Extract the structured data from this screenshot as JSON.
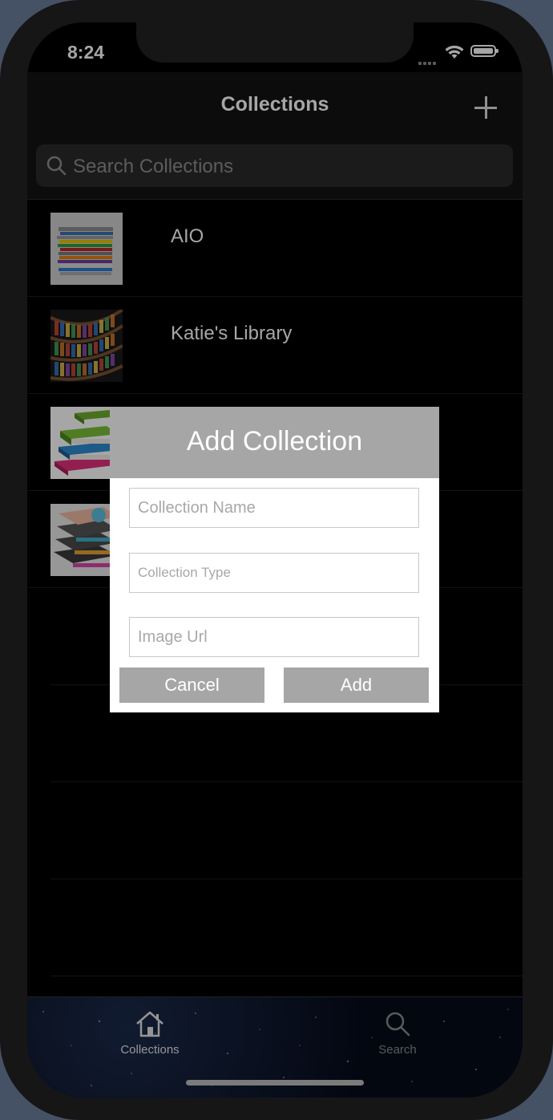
{
  "status": {
    "time": "8:24"
  },
  "nav": {
    "title": "Collections"
  },
  "search": {
    "placeholder": "Search Collections"
  },
  "collections": [
    {
      "name": "AIO"
    },
    {
      "name": "Katie's Library"
    },
    {
      "name": ""
    },
    {
      "name": ""
    }
  ],
  "tabs": [
    {
      "label": "Collections",
      "icon": "home-icon"
    },
    {
      "label": "Search",
      "icon": "search-icon"
    }
  ],
  "dialog": {
    "title": "Add Collection",
    "fields": [
      {
        "placeholder": "Collection Name"
      },
      {
        "placeholder": "Collection Type"
      },
      {
        "placeholder": "Image Url"
      }
    ],
    "cancel_label": "Cancel",
    "add_label": "Add"
  },
  "colors": {
    "dialog_header": "#a6a6a6",
    "background": "#000000"
  }
}
